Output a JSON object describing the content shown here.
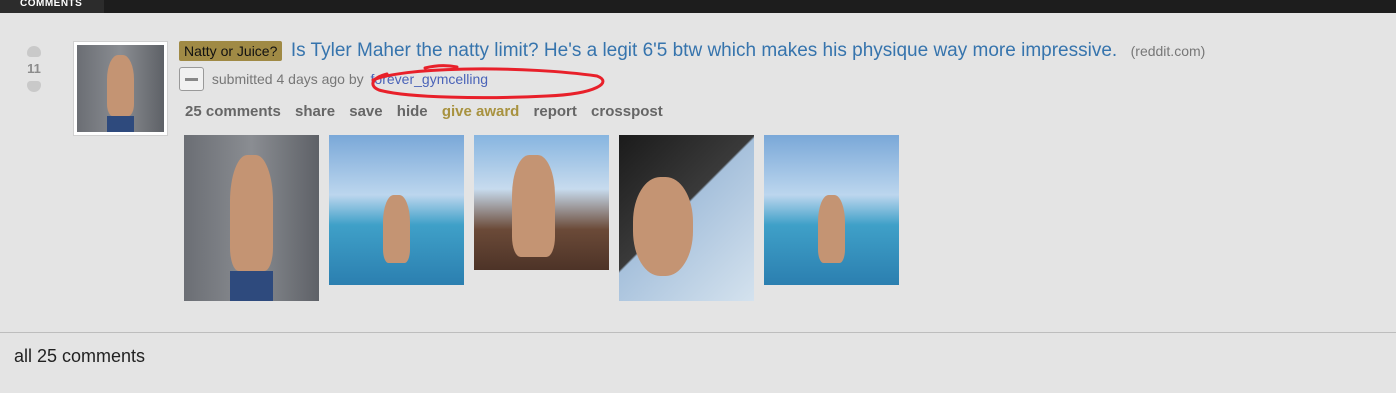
{
  "topbar": {
    "tab_label": "COMMENTS"
  },
  "post": {
    "score": "11",
    "flair": "Natty or Juice?",
    "title": "Is Tyler Maher the natty limit? He's a legit 6'5 btw which makes his physique way more impressive.",
    "domain": "(reddit.com)",
    "submitted": "submitted 4 days ago by",
    "author": "forever_gymcelling",
    "buttons": {
      "comments": "25 comments",
      "share": "share",
      "save": "save",
      "hide": "hide",
      "give_award": "give award",
      "report": "report",
      "crosspost": "crosspost"
    },
    "gallery_scenes": [
      "wall",
      "pool",
      "patio",
      "car",
      "pool"
    ]
  },
  "comments_header": "all 25 comments",
  "annotation_color": "#e8202a"
}
